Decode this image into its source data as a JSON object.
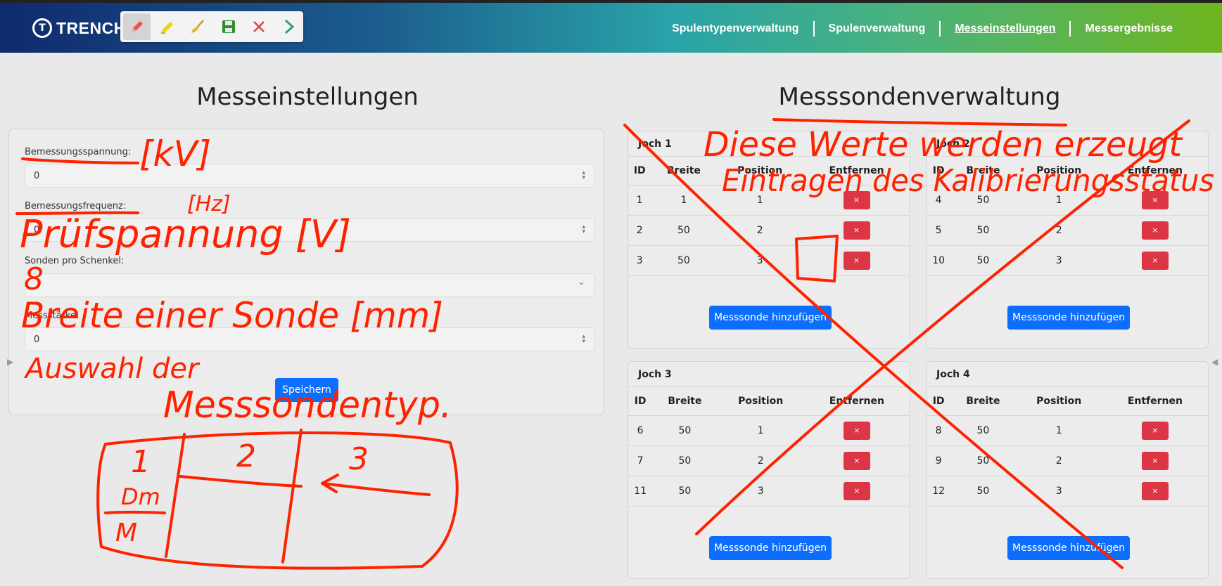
{
  "brand": {
    "name": "TRENCH"
  },
  "toolbar": {
    "tools": [
      "pen-icon",
      "highlighter-icon",
      "broom-icon",
      "save-icon",
      "close-icon",
      "chevron-right-icon"
    ]
  },
  "nav": {
    "items": [
      "Spulentypenverwaltung",
      "Spulenverwaltung",
      "Messeinstellungen",
      "Messergebnisse"
    ],
    "active": "Messeinstellungen"
  },
  "left": {
    "title": "Messeinstellungen",
    "fields": [
      {
        "label": "Bemessungsspannung:",
        "value": "0"
      },
      {
        "label": "Bemessungsfrequenz:",
        "value": "0"
      },
      {
        "label": "Sonden pro Schenkel:",
        "value": ""
      },
      {
        "label": "Messstärke:",
        "value": "0"
      }
    ],
    "save_label": "Speichern"
  },
  "right": {
    "title": "Messsondenverwaltung",
    "columns": [
      "ID",
      "Breite",
      "Position",
      "Entfernen"
    ],
    "delete_label": "×",
    "add_label": "Messsonde hinzufügen",
    "jochs": [
      {
        "name": "Joch 1",
        "rows": [
          [
            "1",
            "1",
            "1"
          ],
          [
            "2",
            "50",
            "2"
          ],
          [
            "3",
            "50",
            "3"
          ]
        ]
      },
      {
        "name": "Joch 2",
        "rows": [
          [
            "4",
            "50",
            "1"
          ],
          [
            "5",
            "50",
            "2"
          ],
          [
            "10",
            "50",
            "3"
          ]
        ]
      },
      {
        "name": "Joch 3",
        "rows": [
          [
            "6",
            "50",
            "1"
          ],
          [
            "7",
            "50",
            "2"
          ],
          [
            "11",
            "50",
            "3"
          ]
        ]
      },
      {
        "name": "Joch 4",
        "rows": [
          [
            "8",
            "50",
            "1"
          ],
          [
            "9",
            "50",
            "2"
          ],
          [
            "12",
            "50",
            "3"
          ]
        ]
      }
    ]
  },
  "annotations": {
    "kv": "[kV]",
    "hz": "[Hz]",
    "pruefspannung": "Prüfspannung [V]",
    "eight": "8",
    "breite": "Breite einer Sonde [mm]",
    "auswahl": "Auswahl der",
    "messsondentyp": "Messsondentyp.",
    "werte": "Diese Werte werden erzeugt",
    "eintragen": "Eintragen des Kalibrierungsstatus",
    "cell1": "1",
    "cell2": "2",
    "cell3": "3",
    "dm": "Dm",
    "m": "M"
  },
  "colors": {
    "ink": "#ff2200",
    "primary": "#0d6efd",
    "danger": "#dc3545"
  }
}
